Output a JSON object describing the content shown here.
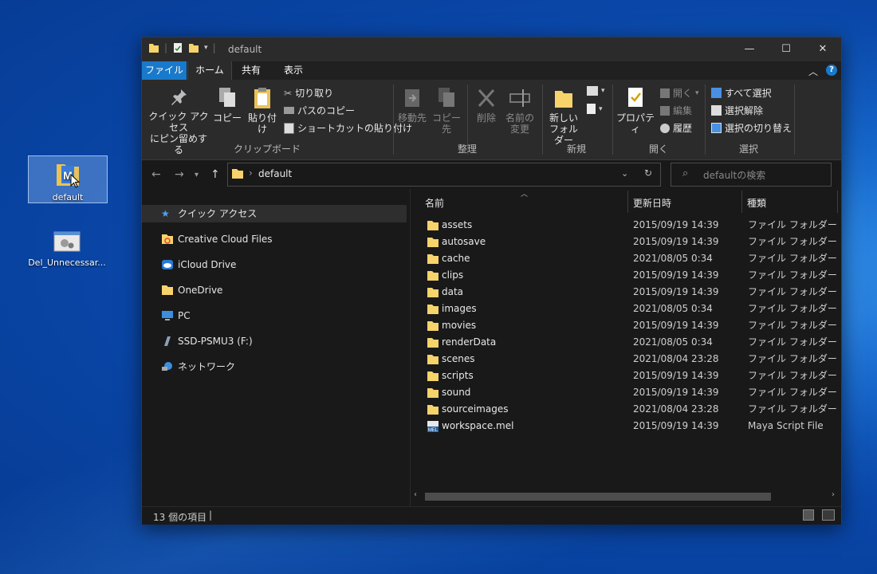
{
  "desktop": {
    "icons": [
      {
        "label": "default"
      },
      {
        "label": "Del_Unnecessar..."
      }
    ]
  },
  "window": {
    "title": "default",
    "controls": {
      "minimize": "—",
      "maximize": "☐",
      "close": "✕"
    }
  },
  "ribbon": {
    "tabs": {
      "file": "ファイル",
      "home": "ホーム",
      "share": "共有",
      "view": "表示"
    },
    "clipboard": {
      "pin_line1": "クイック アクセス",
      "pin_line2": "にピン留めする",
      "copy": "コピー",
      "paste": "貼り付け",
      "cut": "切り取り",
      "copy_path": "パスのコピー",
      "paste_shortcut": "ショートカットの貼り付け",
      "group": "クリップボード"
    },
    "organize": {
      "move_to": "移動先",
      "copy_to": "コピー先",
      "delete": "削除",
      "rename_line1": "名前の",
      "rename_line2": "変更",
      "group": "整理"
    },
    "new": {
      "new_folder_line1": "新しい",
      "new_folder_line2": "フォルダー",
      "group": "新規"
    },
    "open": {
      "properties": "プロパティ",
      "open": "開く",
      "edit": "編集",
      "history": "履歴",
      "group": "開く"
    },
    "select": {
      "select_all": "すべて選択",
      "select_none": "選択解除",
      "invert": "選択の切り替え",
      "group": "選択"
    }
  },
  "address": {
    "path": "default",
    "search_placeholder": "defaultの検索"
  },
  "nav": {
    "items": [
      {
        "label": "クイック アクセス",
        "icon": "star-icon"
      },
      {
        "label": "Creative Cloud Files",
        "icon": "creative-cloud-icon"
      },
      {
        "label": "iCloud Drive",
        "icon": "icloud-icon"
      },
      {
        "label": "OneDrive",
        "icon": "folder-icon"
      },
      {
        "label": "PC",
        "icon": "pc-icon"
      },
      {
        "label": "SSD-PSMU3 (F:)",
        "icon": "drive-icon"
      },
      {
        "label": "ネットワーク",
        "icon": "network-icon"
      }
    ]
  },
  "list": {
    "columns": {
      "name": "名前",
      "date": "更新日時",
      "type": "種類"
    },
    "rows": [
      {
        "name": "assets",
        "date": "2015/09/19 14:39",
        "type": "ファイル フォルダー",
        "icon": "folder-icon"
      },
      {
        "name": "autosave",
        "date": "2015/09/19 14:39",
        "type": "ファイル フォルダー",
        "icon": "folder-icon"
      },
      {
        "name": "cache",
        "date": "2021/08/05 0:34",
        "type": "ファイル フォルダー",
        "icon": "folder-icon"
      },
      {
        "name": "clips",
        "date": "2015/09/19 14:39",
        "type": "ファイル フォルダー",
        "icon": "folder-icon"
      },
      {
        "name": "data",
        "date": "2015/09/19 14:39",
        "type": "ファイル フォルダー",
        "icon": "folder-icon"
      },
      {
        "name": "images",
        "date": "2021/08/05 0:34",
        "type": "ファイル フォルダー",
        "icon": "folder-icon"
      },
      {
        "name": "movies",
        "date": "2015/09/19 14:39",
        "type": "ファイル フォルダー",
        "icon": "folder-icon"
      },
      {
        "name": "renderData",
        "date": "2021/08/05 0:34",
        "type": "ファイル フォルダー",
        "icon": "folder-icon"
      },
      {
        "name": "scenes",
        "date": "2021/08/04 23:28",
        "type": "ファイル フォルダー",
        "icon": "folder-icon"
      },
      {
        "name": "scripts",
        "date": "2015/09/19 14:39",
        "type": "ファイル フォルダー",
        "icon": "folder-icon"
      },
      {
        "name": "sound",
        "date": "2015/09/19 14:39",
        "type": "ファイル フォルダー",
        "icon": "folder-icon"
      },
      {
        "name": "sourceimages",
        "date": "2021/08/04 23:28",
        "type": "ファイル フォルダー",
        "icon": "folder-icon"
      },
      {
        "name": "workspace.mel",
        "date": "2015/09/19 14:39",
        "type": "Maya Script File",
        "icon": "mel-file-icon"
      }
    ]
  },
  "status": {
    "count": "13 個の項目"
  },
  "colors": {
    "accent": "#1979ca",
    "folder": "#f7d36b",
    "bg": "#191919"
  }
}
